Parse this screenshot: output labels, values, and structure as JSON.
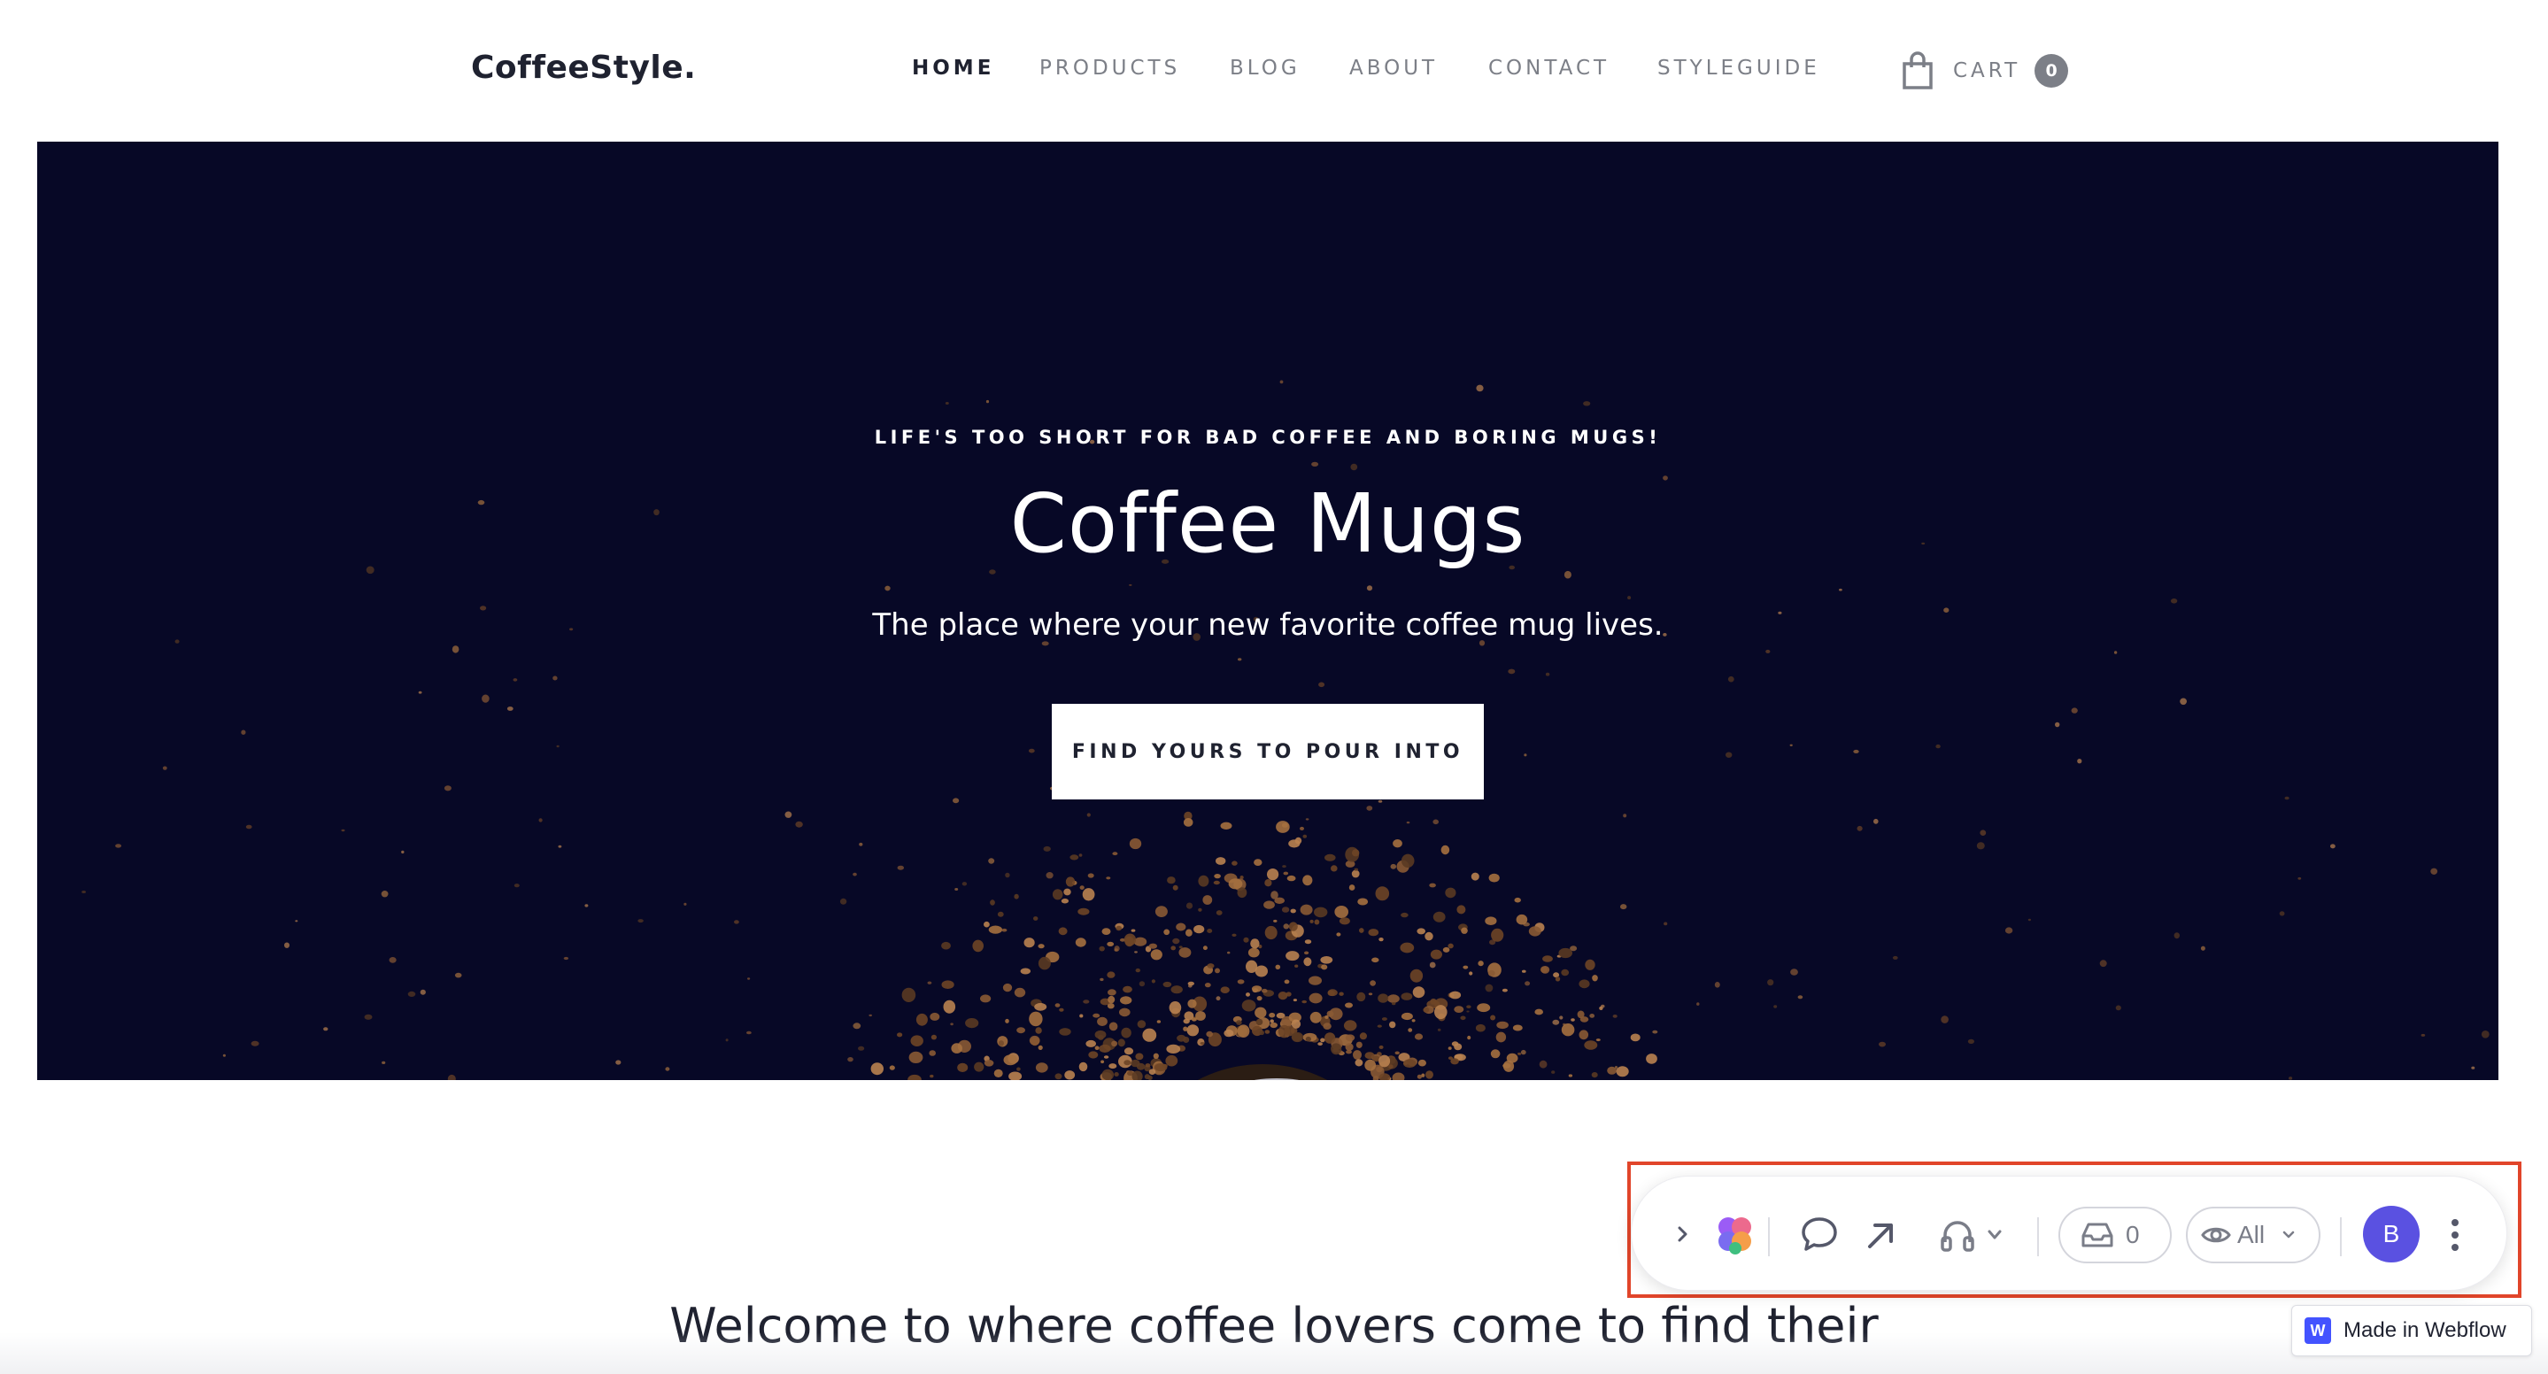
{
  "header": {
    "brand": "CoffeeStyle.",
    "nav": [
      {
        "label": "HOME",
        "active": true
      },
      {
        "label": "PRODUCTS",
        "active": false
      },
      {
        "label": "BLOG",
        "active": false
      },
      {
        "label": "ABOUT",
        "active": false
      },
      {
        "label": "CONTACT",
        "active": false
      },
      {
        "label": "STYLEGUIDE",
        "active": false
      }
    ],
    "cart": {
      "label": "CART",
      "count": "0",
      "icon": "shopping-bag-icon"
    }
  },
  "hero": {
    "eyebrow": "LIFE'S TOO SHORT FOR BAD COFFEE AND BORING MUGS!",
    "title": "Coffee Mugs",
    "subtitle": "The place where your new favorite coffee mug lives.",
    "cta_label": "FIND YOURS TO POUR INTO",
    "background_color": "#070826"
  },
  "main": {
    "welcome_heading": "Welcome to where coffee lovers come to find their"
  },
  "toolbar": {
    "collapse_icon": "chevron-right-icon",
    "app_icon": "multicolor-petals-icon",
    "comment_icon": "speech-bubble-icon",
    "share_icon": "arrow-up-right-icon",
    "huddle_icon": "headphones-icon",
    "huddle_dropdown_icon": "chevron-down-icon",
    "inbox": {
      "icon": "inbox-tray-icon",
      "count": "0"
    },
    "visibility": {
      "icon": "eye-icon",
      "label": "All",
      "dropdown_icon": "chevron-down-icon"
    },
    "avatar_initial": "B",
    "avatar_color": "#5a51e1",
    "more_icon": "vertical-dots-icon",
    "highlight_color": "#e1452a"
  },
  "webflow_badge": {
    "logo_letter": "W",
    "label": "Made in Webflow",
    "brand_color": "#4353ff"
  }
}
